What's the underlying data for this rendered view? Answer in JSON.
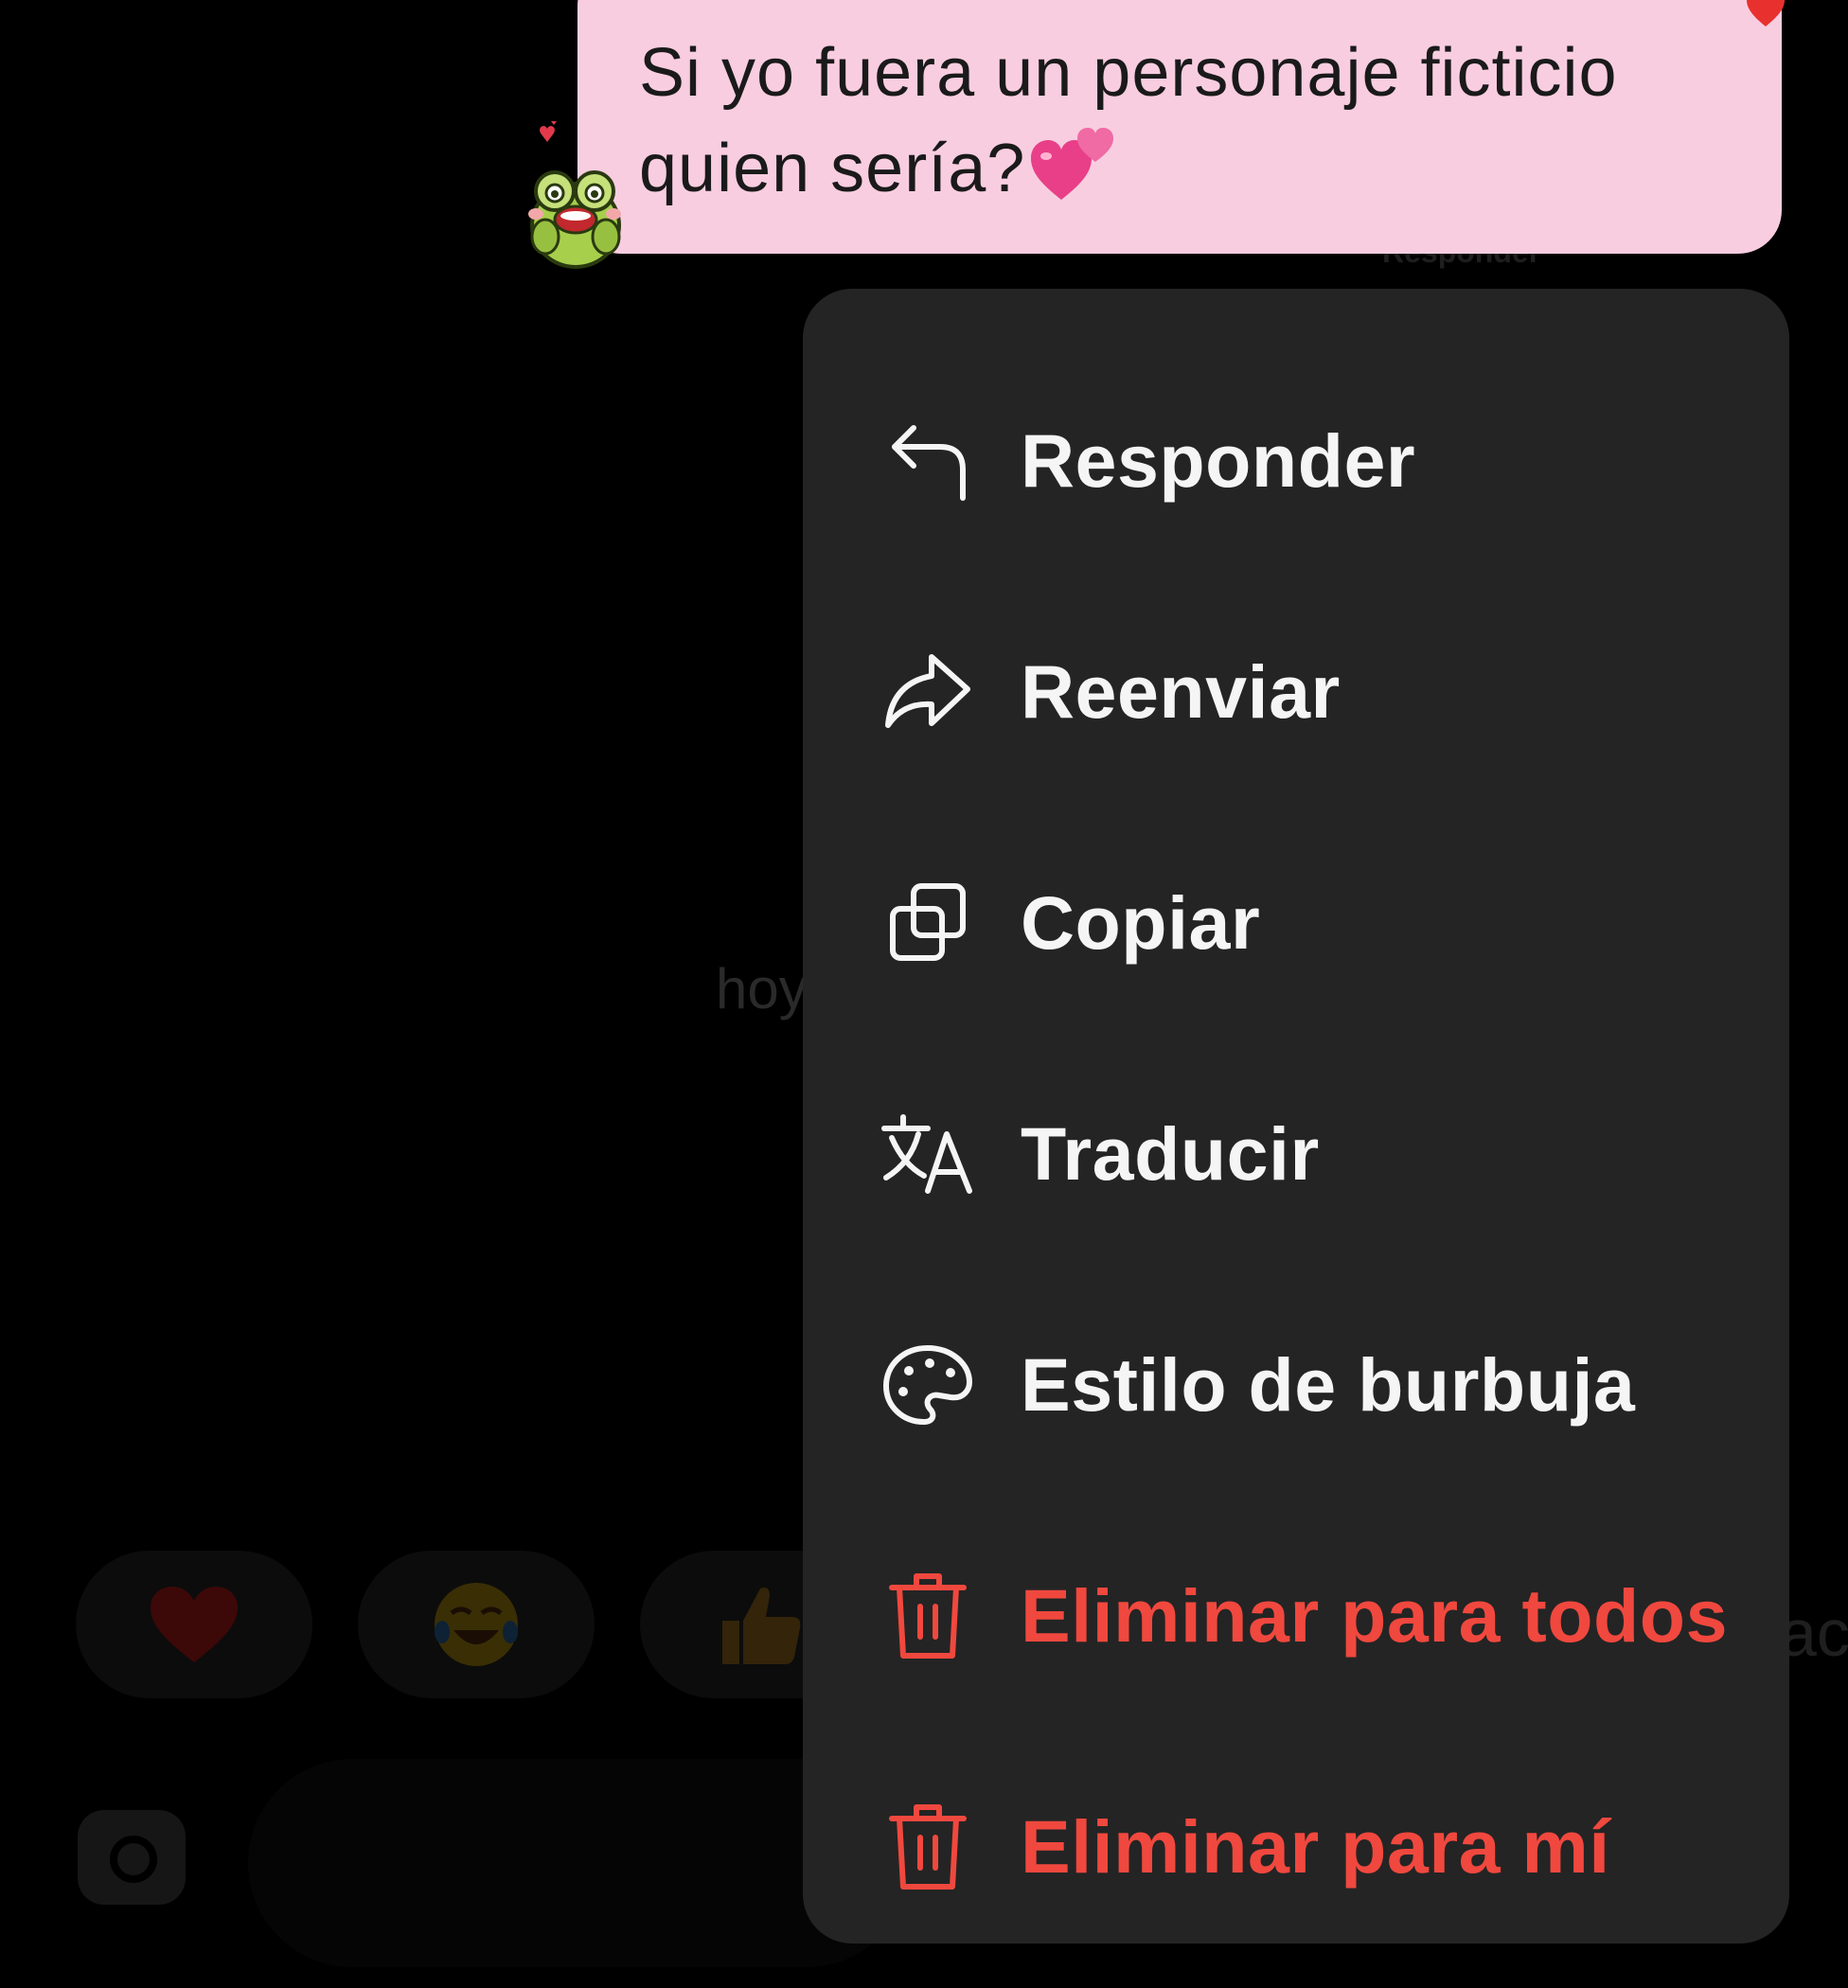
{
  "message": {
    "line1": "Si yo fuera un personaje ficticio",
    "line2": "quien sería?",
    "emoji": "two-hearts"
  },
  "background": {
    "date_hint": "hoy",
    "reply_hint": "Responder",
    "reactions": [
      "red-heart",
      "tears-of-joy",
      "thumbs-up"
    ],
    "right_edge_text": "ac"
  },
  "menu": {
    "items": [
      {
        "label": "Responder",
        "icon": "reply-arrow-icon",
        "color": "#f5f5f5"
      },
      {
        "label": "Reenviar",
        "icon": "forward-arrow-icon",
        "color": "#f5f5f5"
      },
      {
        "label": "Copiar",
        "icon": "copy-icon",
        "color": "#f5f5f5"
      },
      {
        "label": "Traducir",
        "icon": "translate-icon",
        "color": "#f5f5f5"
      },
      {
        "label": "Estilo de burbuja",
        "icon": "palette-icon",
        "color": "#f5f5f5"
      },
      {
        "label": "Eliminar para todos",
        "icon": "trash-icon",
        "color": "#f0483e"
      },
      {
        "label": "Eliminar para mí",
        "icon": "trash-icon",
        "color": "#f0483e"
      }
    ]
  },
  "colors": {
    "bubble": "#f9cde0",
    "menu_bg": "#242424",
    "danger": "#f0483e"
  }
}
